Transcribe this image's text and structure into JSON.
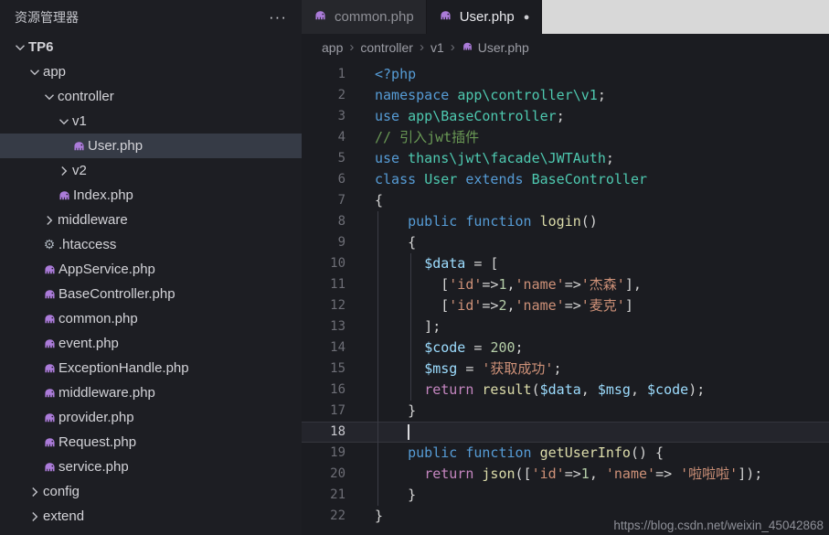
{
  "colors": {
    "php_icon": "#ab7bd9",
    "selected_row_bg": "#363b46",
    "editor_bg": "#1b1c21",
    "sidebar_bg": "#1d1e23",
    "tab_strip_bg": "#d8d8d8"
  },
  "sidebar": {
    "title": "资源管理器",
    "more_label": "···",
    "tree": [
      {
        "name": "TP6",
        "depth": 0,
        "kind": "folder",
        "state": "open",
        "root": true
      },
      {
        "name": "app",
        "depth": 1,
        "kind": "folder",
        "state": "open"
      },
      {
        "name": "controller",
        "depth": 2,
        "kind": "folder",
        "state": "open"
      },
      {
        "name": "v1",
        "depth": 3,
        "kind": "folder",
        "state": "open"
      },
      {
        "name": "User.php",
        "depth": 4,
        "kind": "php",
        "selected": true
      },
      {
        "name": "v2",
        "depth": 3,
        "kind": "folder",
        "state": "closed"
      },
      {
        "name": "Index.php",
        "depth": 3,
        "kind": "php"
      },
      {
        "name": "middleware",
        "depth": 2,
        "kind": "folder",
        "state": "closed"
      },
      {
        "name": ".htaccess",
        "depth": 2,
        "kind": "gear"
      },
      {
        "name": "AppService.php",
        "depth": 2,
        "kind": "php"
      },
      {
        "name": "BaseController.php",
        "depth": 2,
        "kind": "php"
      },
      {
        "name": "common.php",
        "depth": 2,
        "kind": "php"
      },
      {
        "name": "event.php",
        "depth": 2,
        "kind": "php"
      },
      {
        "name": "ExceptionHandle.php",
        "depth": 2,
        "kind": "php"
      },
      {
        "name": "middleware.php",
        "depth": 2,
        "kind": "php"
      },
      {
        "name": "provider.php",
        "depth": 2,
        "kind": "php"
      },
      {
        "name": "Request.php",
        "depth": 2,
        "kind": "php"
      },
      {
        "name": "service.php",
        "depth": 2,
        "kind": "php"
      },
      {
        "name": "config",
        "depth": 1,
        "kind": "folder",
        "state": "closed"
      },
      {
        "name": "extend",
        "depth": 1,
        "kind": "folder",
        "state": "closed"
      }
    ]
  },
  "tabs": [
    {
      "label": "common.php",
      "icon": "php-icon",
      "active": false,
      "dirty": false
    },
    {
      "label": "User.php",
      "icon": "php-icon",
      "active": true,
      "dirty": true
    }
  ],
  "breadcrumb": {
    "separator": "›",
    "items": [
      "app",
      "controller",
      "v1",
      "User.php"
    ],
    "file_icon": "php-icon"
  },
  "editor": {
    "cursor_line": 18,
    "token_colors": {
      "kw": "#569CD6",
      "type": "#4EC9B0",
      "fn": "#DCDCAA",
      "var": "#9CDCFE",
      "str": "#CE9178",
      "num": "#B5CEA8",
      "cmt": "#6A9955",
      "pun": "#D4D4D4",
      "ctrl": "#C586C0"
    },
    "lines": [
      {
        "n": 1,
        "tokens": [
          [
            "kw",
            "<?php"
          ]
        ]
      },
      {
        "n": 2,
        "tokens": [
          [
            "kw",
            "namespace"
          ],
          [
            "pun",
            " "
          ],
          [
            "type",
            "app\\controller\\v1"
          ],
          [
            "pun",
            ";"
          ]
        ]
      },
      {
        "n": 3,
        "tokens": [
          [
            "kw",
            "use"
          ],
          [
            "pun",
            " "
          ],
          [
            "type",
            "app\\BaseController"
          ],
          [
            "pun",
            ";"
          ]
        ]
      },
      {
        "n": 4,
        "tokens": [
          [
            "cmt",
            "// 引入jwt插件"
          ]
        ]
      },
      {
        "n": 5,
        "tokens": [
          [
            "kw",
            "use"
          ],
          [
            "pun",
            " "
          ],
          [
            "type",
            "thans\\jwt\\facade\\JWTAuth"
          ],
          [
            "pun",
            ";"
          ]
        ]
      },
      {
        "n": 6,
        "tokens": [
          [
            "kw",
            "class"
          ],
          [
            "pun",
            " "
          ],
          [
            "type",
            "User"
          ],
          [
            "pun",
            " "
          ],
          [
            "kw",
            "extends"
          ],
          [
            "pun",
            " "
          ],
          [
            "type",
            "BaseController"
          ]
        ]
      },
      {
        "n": 7,
        "tokens": [
          [
            "pun",
            "{"
          ]
        ]
      },
      {
        "n": 8,
        "tokens": [
          [
            "pun",
            "    "
          ],
          [
            "kw",
            "public"
          ],
          [
            "pun",
            " "
          ],
          [
            "kw",
            "function"
          ],
          [
            "pun",
            " "
          ],
          [
            "fn",
            "login"
          ],
          [
            "pun",
            "()"
          ]
        ]
      },
      {
        "n": 9,
        "tokens": [
          [
            "pun",
            "    {"
          ]
        ]
      },
      {
        "n": 10,
        "tokens": [
          [
            "pun",
            "      "
          ],
          [
            "var",
            "$data"
          ],
          [
            "pun",
            " = ["
          ]
        ]
      },
      {
        "n": 11,
        "tokens": [
          [
            "pun",
            "        ["
          ],
          [
            "str",
            "'id'"
          ],
          [
            "pun",
            "=>"
          ],
          [
            "num",
            "1"
          ],
          [
            "pun",
            ","
          ],
          [
            "str",
            "'name'"
          ],
          [
            "pun",
            "=>"
          ],
          [
            "str",
            "'杰森'"
          ],
          [
            "pun",
            "],"
          ]
        ]
      },
      {
        "n": 12,
        "tokens": [
          [
            "pun",
            "        ["
          ],
          [
            "str",
            "'id'"
          ],
          [
            "pun",
            "=>"
          ],
          [
            "num",
            "2"
          ],
          [
            "pun",
            ","
          ],
          [
            "str",
            "'name'"
          ],
          [
            "pun",
            "=>"
          ],
          [
            "str",
            "'麦克'"
          ],
          [
            "pun",
            "]"
          ]
        ]
      },
      {
        "n": 13,
        "tokens": [
          [
            "pun",
            "      ];"
          ]
        ]
      },
      {
        "n": 14,
        "tokens": [
          [
            "pun",
            "      "
          ],
          [
            "var",
            "$code"
          ],
          [
            "pun",
            " = "
          ],
          [
            "num",
            "200"
          ],
          [
            "pun",
            ";"
          ]
        ]
      },
      {
        "n": 15,
        "tokens": [
          [
            "pun",
            "      "
          ],
          [
            "var",
            "$msg"
          ],
          [
            "pun",
            " = "
          ],
          [
            "str",
            "'获取成功'"
          ],
          [
            "pun",
            ";"
          ]
        ]
      },
      {
        "n": 16,
        "tokens": [
          [
            "pun",
            "      "
          ],
          [
            "ctrl",
            "return"
          ],
          [
            "pun",
            " "
          ],
          [
            "fn",
            "result"
          ],
          [
            "pun",
            "("
          ],
          [
            "var",
            "$data"
          ],
          [
            "pun",
            ", "
          ],
          [
            "var",
            "$msg"
          ],
          [
            "pun",
            ", "
          ],
          [
            "var",
            "$code"
          ],
          [
            "pun",
            ");"
          ]
        ]
      },
      {
        "n": 17,
        "tokens": [
          [
            "pun",
            "    }"
          ]
        ]
      },
      {
        "n": 18,
        "tokens": [
          [
            "pun",
            "    "
          ]
        ],
        "cursor": true
      },
      {
        "n": 19,
        "tokens": [
          [
            "pun",
            "    "
          ],
          [
            "kw",
            "public"
          ],
          [
            "pun",
            " "
          ],
          [
            "kw",
            "function"
          ],
          [
            "pun",
            " "
          ],
          [
            "fn",
            "getUserInfo"
          ],
          [
            "pun",
            "() {"
          ]
        ]
      },
      {
        "n": 20,
        "tokens": [
          [
            "pun",
            "      "
          ],
          [
            "ctrl",
            "return"
          ],
          [
            "pun",
            " "
          ],
          [
            "fn",
            "json"
          ],
          [
            "pun",
            "(["
          ],
          [
            "str",
            "'id'"
          ],
          [
            "pun",
            "=>"
          ],
          [
            "num",
            "1"
          ],
          [
            "pun",
            ", "
          ],
          [
            "str",
            "'name'"
          ],
          [
            "pun",
            "=> "
          ],
          [
            "str",
            "'啦啦啦'"
          ],
          [
            "pun",
            "]);"
          ]
        ]
      },
      {
        "n": 21,
        "tokens": [
          [
            "pun",
            "    }"
          ]
        ]
      },
      {
        "n": 22,
        "tokens": [
          [
            "pun",
            "}"
          ]
        ]
      }
    ]
  },
  "watermark": "https://blog.csdn.net/weixin_45042868"
}
